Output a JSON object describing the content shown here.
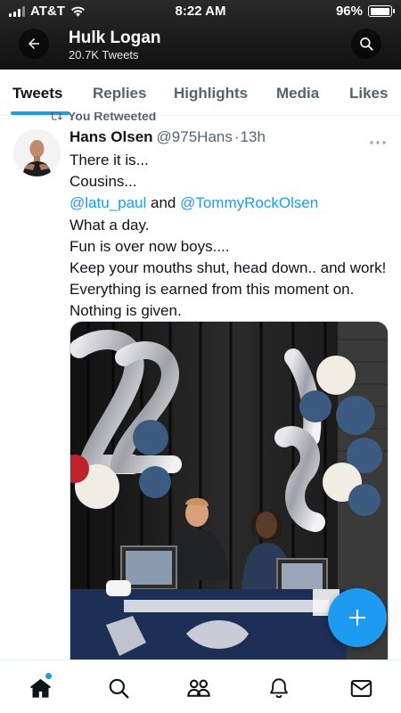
{
  "status_bar": {
    "carrier": "AT&T",
    "time": "8:22 AM",
    "battery": "96%",
    "battery_level": 0.96
  },
  "header": {
    "profile_name": "Hulk Logan",
    "tweet_count": "20.7K Tweets"
  },
  "tabs": [
    {
      "label": "Tweets",
      "active": true
    },
    {
      "label": "Replies",
      "active": false
    },
    {
      "label": "Highlights",
      "active": false
    },
    {
      "label": "Media",
      "active": false
    },
    {
      "label": "Likes",
      "active": false
    }
  ],
  "tweet": {
    "retweet_label": "You Retweeted",
    "author_name": "Hans Olsen",
    "handle": "@975Hans",
    "separator": "·",
    "time_ago": "13h",
    "lines": {
      "l1": "There it is...",
      "l2": "Cousins...",
      "mention1": "@latu_paul",
      "and_text": " and ",
      "mention2": "@TommyRockOlsen",
      "l4": "What a day.",
      "l5": "Fun is over now boys....",
      "l6": "Keep your mouths shut, head down.. and work! Everything is earned from this moment on. Nothing is given."
    }
  },
  "bottom_nav": [
    "home-icon",
    "search-icon",
    "communities-icon",
    "notifications-icon",
    "messages-icon"
  ],
  "colors": {
    "accent": "#1d9bf0",
    "text": "#0f1419",
    "secondary": "#536471"
  }
}
